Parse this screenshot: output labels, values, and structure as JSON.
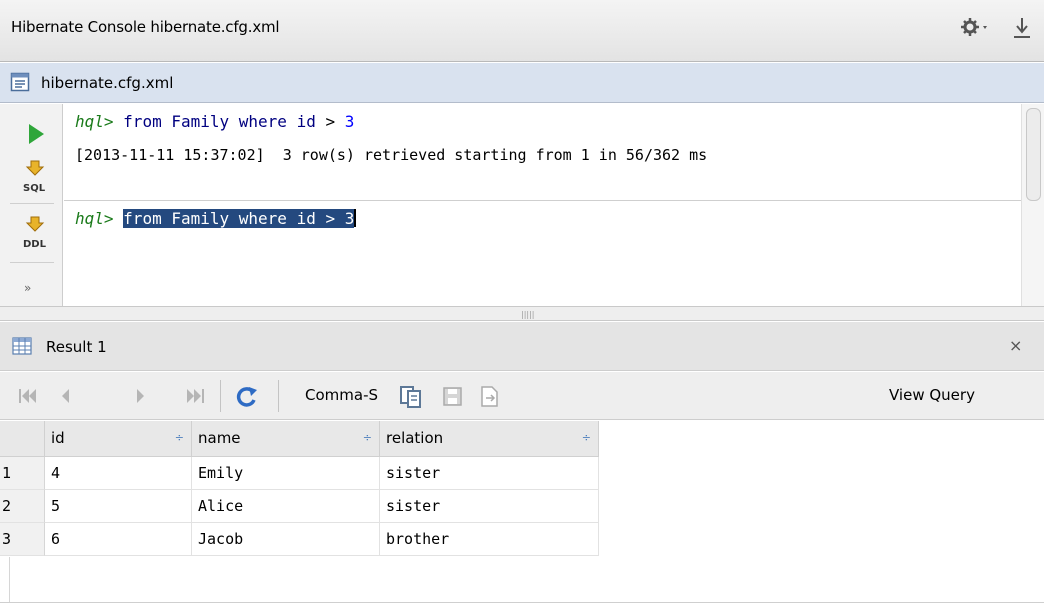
{
  "titlebar": {
    "title": "Hibernate Console  hibernate.cfg.xml",
    "icons": [
      "gear-icon",
      "pin-icon"
    ]
  },
  "console_tab": {
    "label": "hibernate.cfg.xml",
    "icon": "file-icon"
  },
  "side_toolbar": {
    "items": [
      "run-icon",
      "sql-icon",
      "ddl-icon"
    ],
    "more": "»"
  },
  "editor": {
    "line1": {
      "prompt": "hql>",
      "query_text": "from Family where ",
      "id_kw": "id",
      "op": " > ",
      "value": "3"
    },
    "line2": "[2013-11-11 15:37:02]  3 row(s) retrieved starting from 1 in 56/362 ms",
    "line3": {
      "prompt": "hql>",
      "selected": "from Family where id > 3"
    }
  },
  "splitter_grip": "|||||",
  "result": {
    "tab_label": "Result 1",
    "close": "×",
    "toolbar": {
      "comma_label": "Comma-S",
      "view_query": "View Query"
    },
    "columns": [
      {
        "label": "id",
        "sort": "÷"
      },
      {
        "label": "name",
        "sort": "÷"
      },
      {
        "label": "relation",
        "sort": "÷"
      }
    ],
    "rows": [
      {
        "num": "1",
        "id": "4",
        "name": "Emily",
        "relation": "sister"
      },
      {
        "num": "2",
        "id": "5",
        "name": "Alice",
        "relation": "sister"
      },
      {
        "num": "3",
        "id": "6",
        "name": "Jacob",
        "relation": "brother"
      }
    ]
  },
  "colors": {
    "selection": "#24497f",
    "tab_bg": "#d9e2ef",
    "prompt": "#1a7a1a",
    "keyword": "#000080"
  }
}
